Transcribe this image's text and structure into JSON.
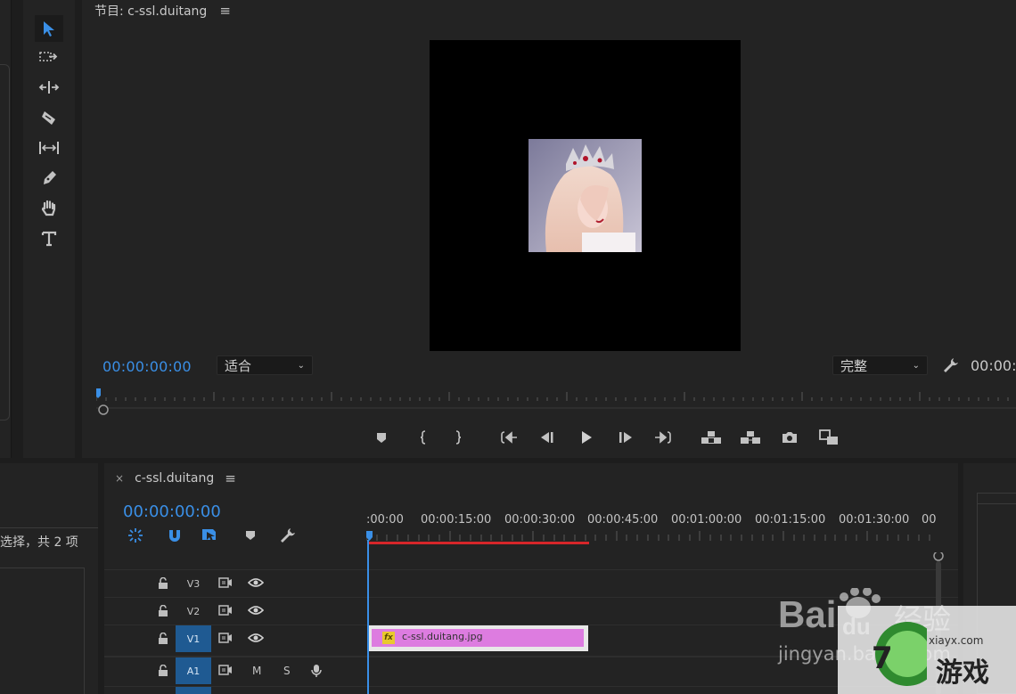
{
  "program": {
    "title": "节目: c-ssl.duitang",
    "menu_icon": "≡",
    "timecode": "00:00:00:00",
    "fit_label": "适合",
    "quality_label": "完整",
    "timecode_right": "00:00:"
  },
  "project": {
    "selection_text": "选择，共 2 项"
  },
  "timeline": {
    "tab_close": "×",
    "sequence_name": "c-ssl.duitang",
    "menu_icon": "≡",
    "timecode": "00:00:00:00",
    "ruler_labels": [
      ":00:00",
      "00:00:15:00",
      "00:00:30:00",
      "00:00:45:00",
      "00:01:00:00",
      "00:01:15:00",
      "00:01:30:00",
      "00"
    ],
    "tracks": [
      {
        "name": "V3",
        "kind": "video",
        "targeted": false
      },
      {
        "name": "V2",
        "kind": "video",
        "targeted": false
      },
      {
        "name": "V1",
        "kind": "video",
        "targeted": true
      },
      {
        "name": "A1",
        "kind": "audio",
        "targeted": true,
        "mute": "M",
        "solo": "S"
      }
    ],
    "clip": {
      "fx": "fx",
      "name": "c-ssl.duitang.jpg"
    }
  },
  "watermarks": {
    "baidu_logo": "Bai du 经验",
    "baidu_url": "jingyan.baidu.com",
    "site_url": "xiayx.com",
    "site_name": "游戏"
  },
  "colors": {
    "accent_blue": "#3a8fe6",
    "clip_pink": "#dd7ce0",
    "work_area_red": "#d6262a",
    "track_target_blue": "#1f5a92"
  }
}
